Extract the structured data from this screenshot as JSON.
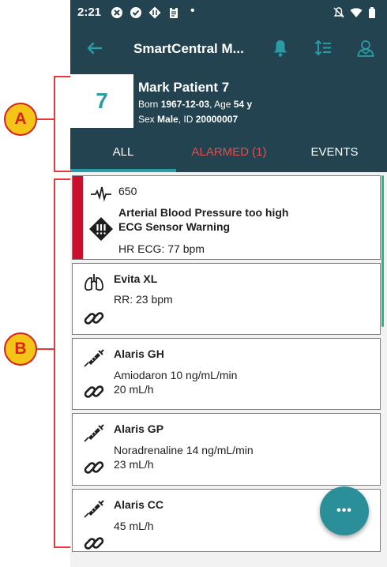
{
  "status_bar": {
    "time": "2:21",
    "dot": "•"
  },
  "app_bar": {
    "title": "SmartCentral M..."
  },
  "patient": {
    "bed": "7",
    "name": "Mark Patient 7",
    "born_label": "Born",
    "born": "1967-12-03",
    "age_label": ", Age",
    "age": "54 y",
    "sex_label": "Sex",
    "sex": "Male",
    "id_label": ", ID",
    "id": "20000007"
  },
  "tabs": [
    {
      "label": "ALL",
      "color": "#ffffff"
    },
    {
      "label": "ALARMED (1)",
      "color": "#e74c4c"
    },
    {
      "label": "EVENTS",
      "color": "#ffffff"
    }
  ],
  "cards": [
    {
      "device": "650",
      "lines": [
        "Arterial Blood Pressure too high",
        "ECG Sensor Warning",
        "HR ECG: 77 bpm"
      ],
      "icon": "ecg-heartbeat-icon",
      "status_icon": "warning-diamond-icon",
      "alarm_color": "#c8102e"
    },
    {
      "device": "Evita XL",
      "lines": [
        "RR: 23 bpm"
      ],
      "icon": "lungs-icon",
      "status_icon": "link-icon"
    },
    {
      "device": "Alaris GH",
      "lines": [
        "Amiodaron 10 ng/mL/min",
        "20 mL/h"
      ],
      "icon": "syringe-icon",
      "status_icon": "link-icon"
    },
    {
      "device": "Alaris GP",
      "lines": [
        "Noradrenaline 14 ng/mL/min",
        "23 mL/h"
      ],
      "icon": "syringe-icon",
      "status_icon": "link-icon"
    },
    {
      "device": "Alaris CC",
      "lines": [
        "45 mL/h"
      ],
      "icon": "syringe-icon",
      "status_icon": "link-icon"
    }
  ],
  "fab": {
    "label": "•••"
  },
  "callouts": {
    "a": "A",
    "b": "B"
  },
  "colors": {
    "header": "#22434f",
    "accent": "#2a9ca6",
    "callout": "#e8383b"
  }
}
